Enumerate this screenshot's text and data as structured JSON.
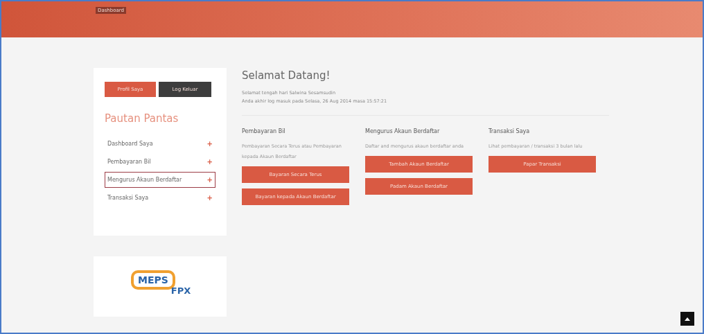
{
  "header": {
    "breadcrumb": "Dashboard"
  },
  "sidebar": {
    "buttons": [
      {
        "label": "Profil Saya",
        "kind": "primary"
      },
      {
        "label": "Log Keluar",
        "kind": "dark"
      }
    ],
    "title": "Pautan Pantas",
    "items": [
      {
        "label": "Dashboard Saya",
        "icon": "+",
        "selected": false
      },
      {
        "label": "Pembayaran Bil",
        "icon": "+",
        "selected": false
      },
      {
        "label": "Mengurus Akaun Berdaftar",
        "icon": "+",
        "selected": true
      },
      {
        "label": "Transaksi Saya",
        "icon": "+",
        "selected": false
      }
    ],
    "logo": {
      "top": "MEPS",
      "bottom": "FPX"
    }
  },
  "welcome": {
    "title": "Selamat Datang!",
    "lines": [
      "Selamat tengah hari Salwina Sesamsudin",
      "Anda akhir log masuk pada Selasa, 26 Aug 2014 masa 15:57:21"
    ]
  },
  "sections": [
    {
      "title": "Pembayaran Bil",
      "text": "Pembayaran Secara Terus atau Pembayaran kepada Akaun Berdaftar",
      "buttons": [
        "Bayaran Secara Terus",
        "Bayaran kepada Akaun Berdaftar"
      ]
    },
    {
      "title": "Mengurus Akaun Berdaftar",
      "text": "Daftar and mengurus akaun berdaftar anda",
      "buttons": [
        "Tambah Akaun Berdaftar",
        "Padam Akaun Berdaftar"
      ]
    },
    {
      "title": "Transaksi Saya",
      "text": "Lihat pembayaran / transaksi 3 bulan lalu",
      "buttons": [
        "Papar Transaksi"
      ]
    }
  ]
}
